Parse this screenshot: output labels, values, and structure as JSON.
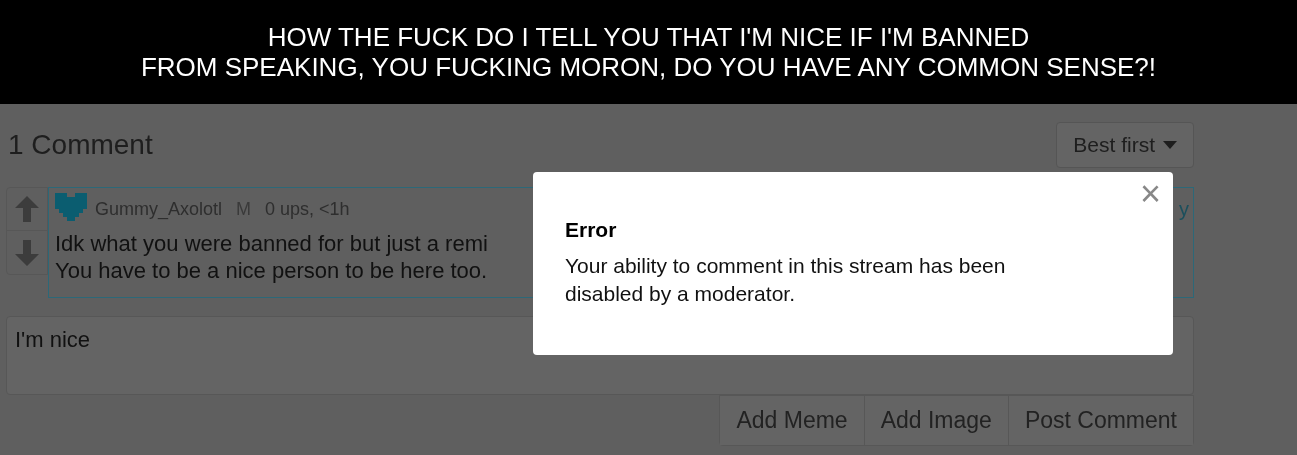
{
  "caption_lines": [
    "HOW THE FUCK DO I TELL YOU THAT I'M NICE IF I'M BANNED",
    "FROM SPEAKING, YOU FUCKING MORON, DO YOU HAVE ANY COMMON SENSE?!"
  ],
  "comments_header": {
    "title": "1 Comment",
    "sort": "Best first"
  },
  "comment": {
    "author": "Gummy_Axolotl",
    "badge": "M",
    "meta": "0 ups, <1h",
    "lines": [
      "Idk what you were banned for but just a remi",
      "You have to be a nice person to be here too."
    ],
    "reply_fragment": "y"
  },
  "reply_box": {
    "value": "I'm nice"
  },
  "buttons": [
    "Add Meme",
    "Add Image",
    "Post Comment"
  ],
  "dialog": {
    "title": "Error",
    "message": "Your ability to comment in this stream has been disabled by a moderator.",
    "close": "×"
  }
}
